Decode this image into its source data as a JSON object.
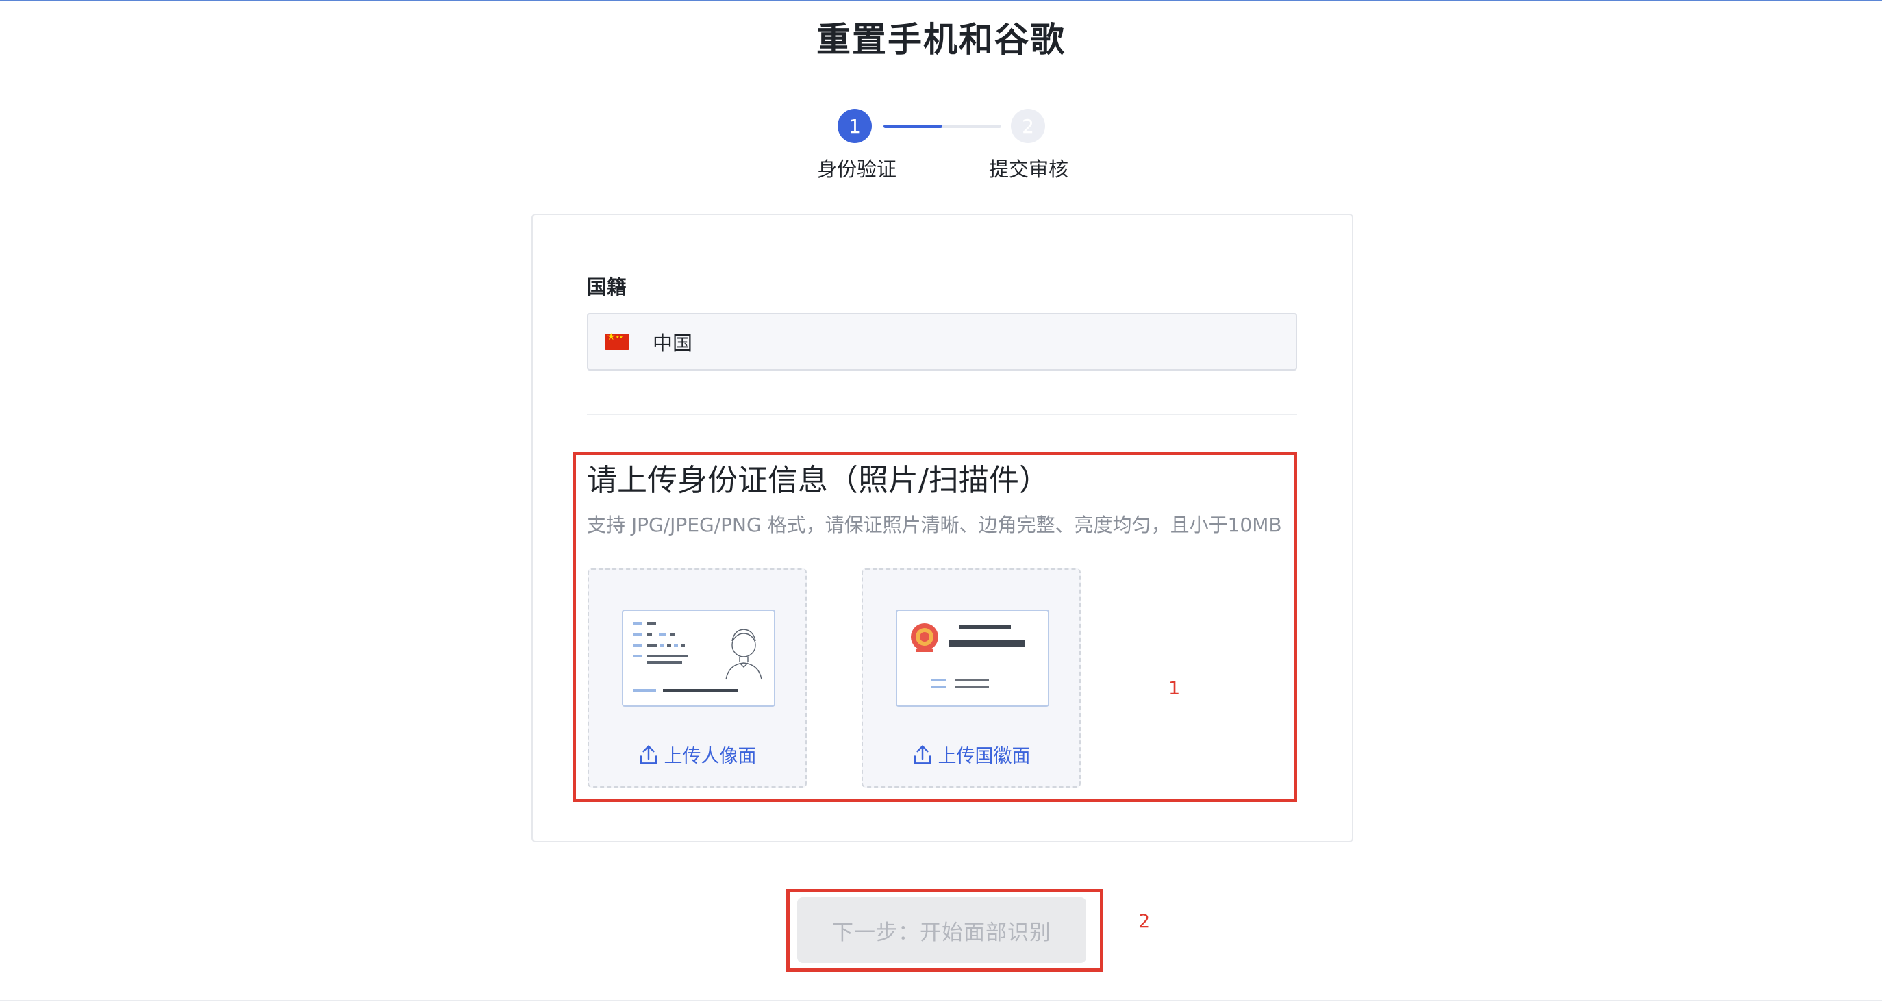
{
  "page": {
    "title": "重置手机和谷歌"
  },
  "stepper": {
    "steps": [
      {
        "number": "1",
        "label": "身份验证",
        "state": "active"
      },
      {
        "number": "2",
        "label": "提交审核",
        "state": "pending"
      }
    ],
    "progress_fraction": 0.5
  },
  "form": {
    "nationality": {
      "label": "国籍",
      "value": "中国",
      "flag_icon": "china-flag-icon"
    },
    "upload": {
      "title": "请上传身份证信息（照片/扫描件）",
      "hint": "支持 JPG/JPEG/PNG 格式，请保证照片清晰、边角完整、亮度均匀，且小于10MB",
      "slots": [
        {
          "label": "上传人像面",
          "icon": "upload-icon",
          "card_side": "portrait"
        },
        {
          "label": "上传国徽面",
          "icon": "upload-icon",
          "card_side": "emblem"
        }
      ]
    }
  },
  "next_button": {
    "label": "下一步：开始面部识别",
    "state": "disabled"
  },
  "annotations": [
    {
      "number": "1",
      "color": "#e03a2f"
    },
    {
      "number": "2",
      "color": "#e03a2f"
    }
  ],
  "colors": {
    "accent": "#3b63db",
    "annotation": "#e03a2f",
    "disabled_bg": "#e9eaec"
  }
}
